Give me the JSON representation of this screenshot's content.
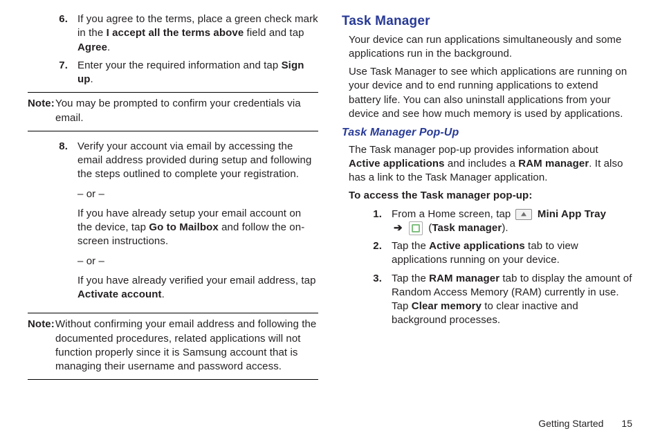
{
  "left": {
    "items678": {
      "6": {
        "num": "6.",
        "t1": "If you agree to the terms, place a green check mark in the ",
        "b1": "I accept all the terms above",
        "t2": " field and tap ",
        "b2": "Agree",
        "t3": "."
      },
      "7": {
        "num": "7.",
        "t1": "Enter your the required information and tap ",
        "b1": "Sign up",
        "t2": "."
      },
      "8": {
        "num": "8.",
        "a": "Verify your account via email by accessing the email address provided during setup and following the steps outlined to complete your registration.",
        "or": "– or –",
        "b_t1": "If you have already setup your email account on the device, tap ",
        "b_b1": "Go to Mailbox",
        "b_t2": " and follow the on-screen instructions.",
        "c_t1": "If you have already verified your email address, tap ",
        "c_b1": "Activate account",
        "c_t2": "."
      }
    },
    "note1": {
      "label": "Note:",
      "body": "You may be prompted to confirm your credentials via email."
    },
    "note2": {
      "label": "Note:",
      "body": "Without confirming your email address and following the documented procedures, related applications will not function properly since it is Samsung account that is managing their username and password access."
    }
  },
  "right": {
    "h2": "Task Manager",
    "p1": "Your device can run applications simultaneously and some applications run in the background.",
    "p2": "Use Task Manager to see which applications are running on your device and to end running applications to extend battery life. You can also uninstall applications from your device and see how much memory is used by applications.",
    "h3": "Task Manager Pop-Up",
    "p3_a": "The Task manager pop-up provides information about ",
    "p3_b1": "Active applications",
    "p3_b": " and includes a ",
    "p3_b2": "RAM manager",
    "p3_c": ". It also has a link to the Task Manager application.",
    "lead": "To access the Task manager pop-up:",
    "steps": {
      "1": {
        "num": "1.",
        "t1": "From a Home screen, tap ",
        "b1": "Mini App Tray",
        "t2": " (",
        "b2": "Task manager",
        "t3": ")."
      },
      "2": {
        "num": "2.",
        "t1": "Tap the ",
        "b1": "Active applications",
        "t2": " tab to view applications running on your device."
      },
      "3": {
        "num": "3.",
        "t1": "Tap the ",
        "b1": "RAM manager",
        "t2": " tab to display the amount of Random Access Memory (RAM) currently in use. Tap ",
        "b2": "Clear memory",
        "t3": " to clear inactive and background processes."
      }
    }
  },
  "footer": {
    "section": "Getting Started",
    "page": "15"
  },
  "arrow_glyph": "➔"
}
